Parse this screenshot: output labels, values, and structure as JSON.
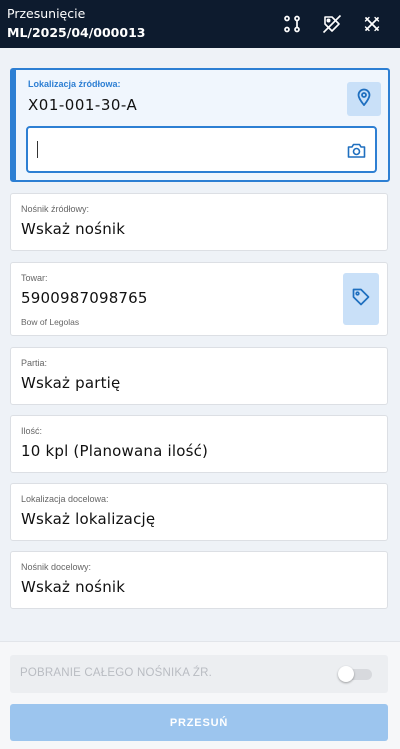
{
  "header": {
    "title": "Przesunięcie",
    "document_number": "ML/2025/04/000013",
    "icons": [
      "route-icon",
      "no-tag-icon",
      "close-icon"
    ]
  },
  "source_location": {
    "label": "Lokalizacja źródłowa:",
    "value": "X01-001-30-A",
    "scan_input_value": "",
    "accent_color": "#2d7fd3"
  },
  "source_carrier": {
    "label": "Nośnik źródłowy:",
    "value": "Wskaż nośnik"
  },
  "item": {
    "label": "Towar:",
    "code": "5900987098765",
    "name": "Bow of Legolas"
  },
  "batch": {
    "label": "Partia:",
    "value": "Wskaż partię"
  },
  "quantity": {
    "label": "Ilość:",
    "value": "10 kpl (Planowana ilość)"
  },
  "target_location": {
    "label": "Lokalizacja docelowa:",
    "value": "Wskaż lokalizację"
  },
  "target_carrier": {
    "label": "Nośnik docelowy:",
    "value": "Wskaż nośnik"
  },
  "footer": {
    "toggle_label": "POBRANIE CAŁEGO NOŚNIKA ŹR.",
    "toggle_on": false,
    "move_button": "PRZESUŃ"
  },
  "colors": {
    "header_bg": "#0d1b2e",
    "button_disabled": "#9cc5ee"
  }
}
